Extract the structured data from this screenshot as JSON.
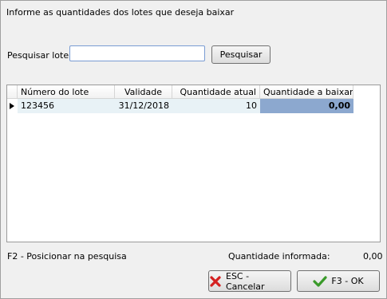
{
  "dialog": {
    "instruction": "Informe as quantidades dos lotes que deseja baixar"
  },
  "search": {
    "label": "Pesquisar lote:",
    "value": "",
    "placeholder": "",
    "button_label": "Pesquisar"
  },
  "grid": {
    "columns": [
      "Número do lote",
      "Validade",
      "Quantidade atual",
      "Quantidade a baixar"
    ],
    "rows": [
      {
        "lote": "123456",
        "validade": "31/12/2018",
        "quantidade_atual": "10",
        "quantidade_baixar": "0,00"
      }
    ]
  },
  "footer": {
    "hint": "F2 - Posicionar na pesquisa",
    "quantity_label": "Quantidade informada:",
    "quantity_value": "0,00",
    "cancel_label": "ESC - Cancelar",
    "ok_label": "F3 - OK"
  },
  "icons": {
    "cancel": "x-icon",
    "ok": "check-icon",
    "row_indicator": "triangle-right-icon"
  },
  "colors": {
    "selected_cell": "#8ca8cf",
    "row_background": "#e8f2f6",
    "cancel_icon": "#d42020",
    "ok_icon": "#3a9a2a"
  }
}
